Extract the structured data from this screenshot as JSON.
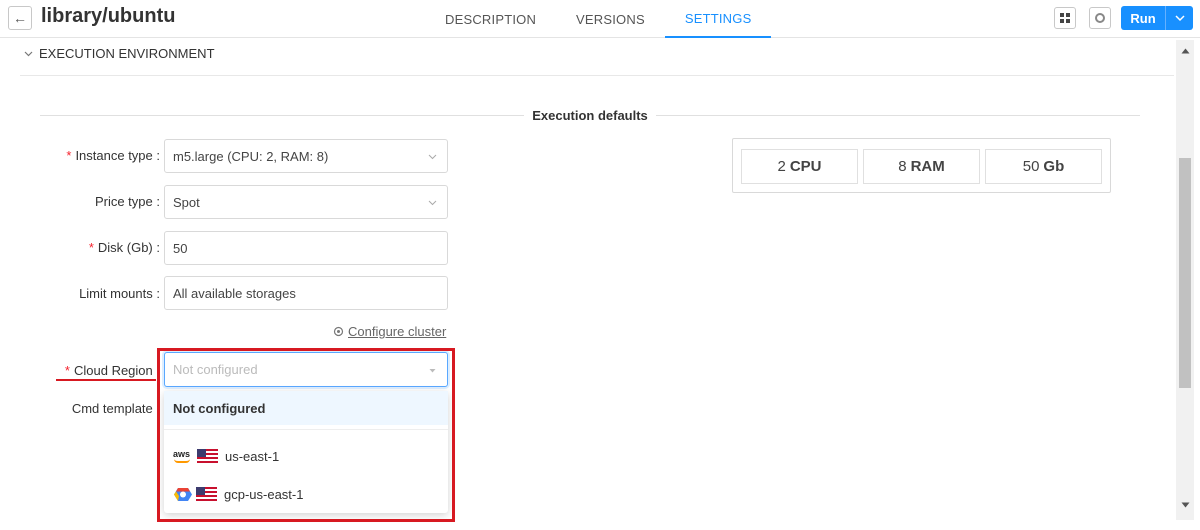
{
  "header": {
    "back_icon": "arrow-left-icon",
    "title": "library/ubuntu",
    "tabs": [
      {
        "label": "DESCRIPTION",
        "active": false
      },
      {
        "label": "VERSIONS",
        "active": false
      },
      {
        "label": "SETTINGS",
        "active": true
      }
    ],
    "run_label": "Run",
    "accent_color": "#1890ff"
  },
  "section": {
    "title": "EXECUTION ENVIRONMENT",
    "fieldset_title": "Execution defaults"
  },
  "form": {
    "instance_type": {
      "label": "Instance type",
      "value": "m5.large (CPU: 2, RAM: 8)",
      "required": true
    },
    "price_type": {
      "label": "Price type",
      "value": "Spot"
    },
    "disk": {
      "label": "Disk (Gb)",
      "value": "50",
      "required": true
    },
    "limit_mounts": {
      "label": "Limit mounts",
      "value": "All available storages"
    },
    "configure_cluster": "Configure cluster",
    "cloud_region": {
      "label": "Cloud Region",
      "placeholder": "Not configured",
      "required": true
    },
    "cmd_template": {
      "label": "Cmd template"
    }
  },
  "region_dropdown": {
    "options": [
      {
        "label": "Not configured",
        "selected": true
      },
      {
        "label": "us-east-1",
        "provider": "aws",
        "flag": "us"
      },
      {
        "label": "gcp-us-east-1",
        "provider": "gcp",
        "flag": "us"
      }
    ]
  },
  "summary": {
    "cpu_value": "2",
    "cpu_unit": "CPU",
    "ram_value": "8",
    "ram_unit": "RAM",
    "disk_value": "50",
    "disk_unit": "Gb"
  },
  "colors": {
    "required_star": "#f5222d",
    "highlight": "#d71921"
  }
}
